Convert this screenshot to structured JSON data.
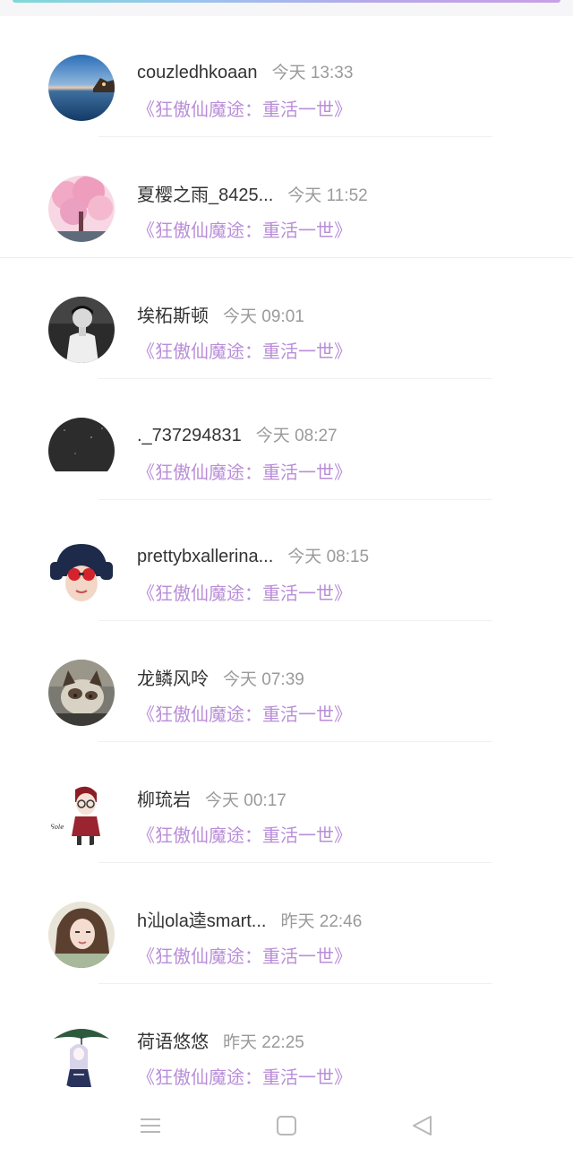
{
  "comments": [
    {
      "username": "couzledhkoaan",
      "time": "今天 13:33",
      "book": "《狂傲仙魔途：重活一世》",
      "avatar_icon": "lake-sunset-avatar-icon"
    },
    {
      "username": "夏樱之雨_8425...",
      "time": "今天 11:52",
      "book": "《狂傲仙魔途：重活一世》",
      "avatar_icon": "cherry-blossom-avatar-icon"
    },
    {
      "username": "埃柘斯顿",
      "time": "今天 09:01",
      "book": "《狂傲仙魔途：重活一世》",
      "avatar_icon": "person-bw-avatar-icon"
    },
    {
      "username": "._737294831",
      "time": "今天 08:27",
      "book": "《狂傲仙魔途：重活一世》",
      "avatar_icon": "dark-night-avatar-icon"
    },
    {
      "username": "prettybxallerina...",
      "time": "今天 08:15",
      "book": "《狂傲仙魔途：重活一世》",
      "avatar_icon": "hat-sunglasses-avatar-icon"
    },
    {
      "username": "龙鳞风呤",
      "time": "今天 07:39",
      "book": "《狂傲仙魔途：重活一世》",
      "avatar_icon": "cat-avatar-icon"
    },
    {
      "username": "柳琉岩",
      "time": "今天 00:17",
      "book": "《狂傲仙魔途：重活一世》",
      "avatar_icon": "cartoon-boy-avatar-icon"
    },
    {
      "username": "h汕ola逵smart...",
      "time": "昨天 22:46",
      "book": "《狂傲仙魔途：重活一世》",
      "avatar_icon": "woman-portrait-avatar-icon"
    },
    {
      "username": "荷语悠悠",
      "time": "昨天 22:25",
      "book": "《狂傲仙魔途：重活一世》",
      "avatar_icon": "anime-girl-umbrella-avatar-icon"
    }
  ],
  "navbar": {
    "menu_icon": "menu-icon",
    "home_icon": "home-square-icon",
    "back_icon": "back-triangle-icon"
  },
  "colors": {
    "username": "#333333",
    "time": "#9a9a9a",
    "book_link": "#b98ed8",
    "divider": "#f0f0f0"
  }
}
